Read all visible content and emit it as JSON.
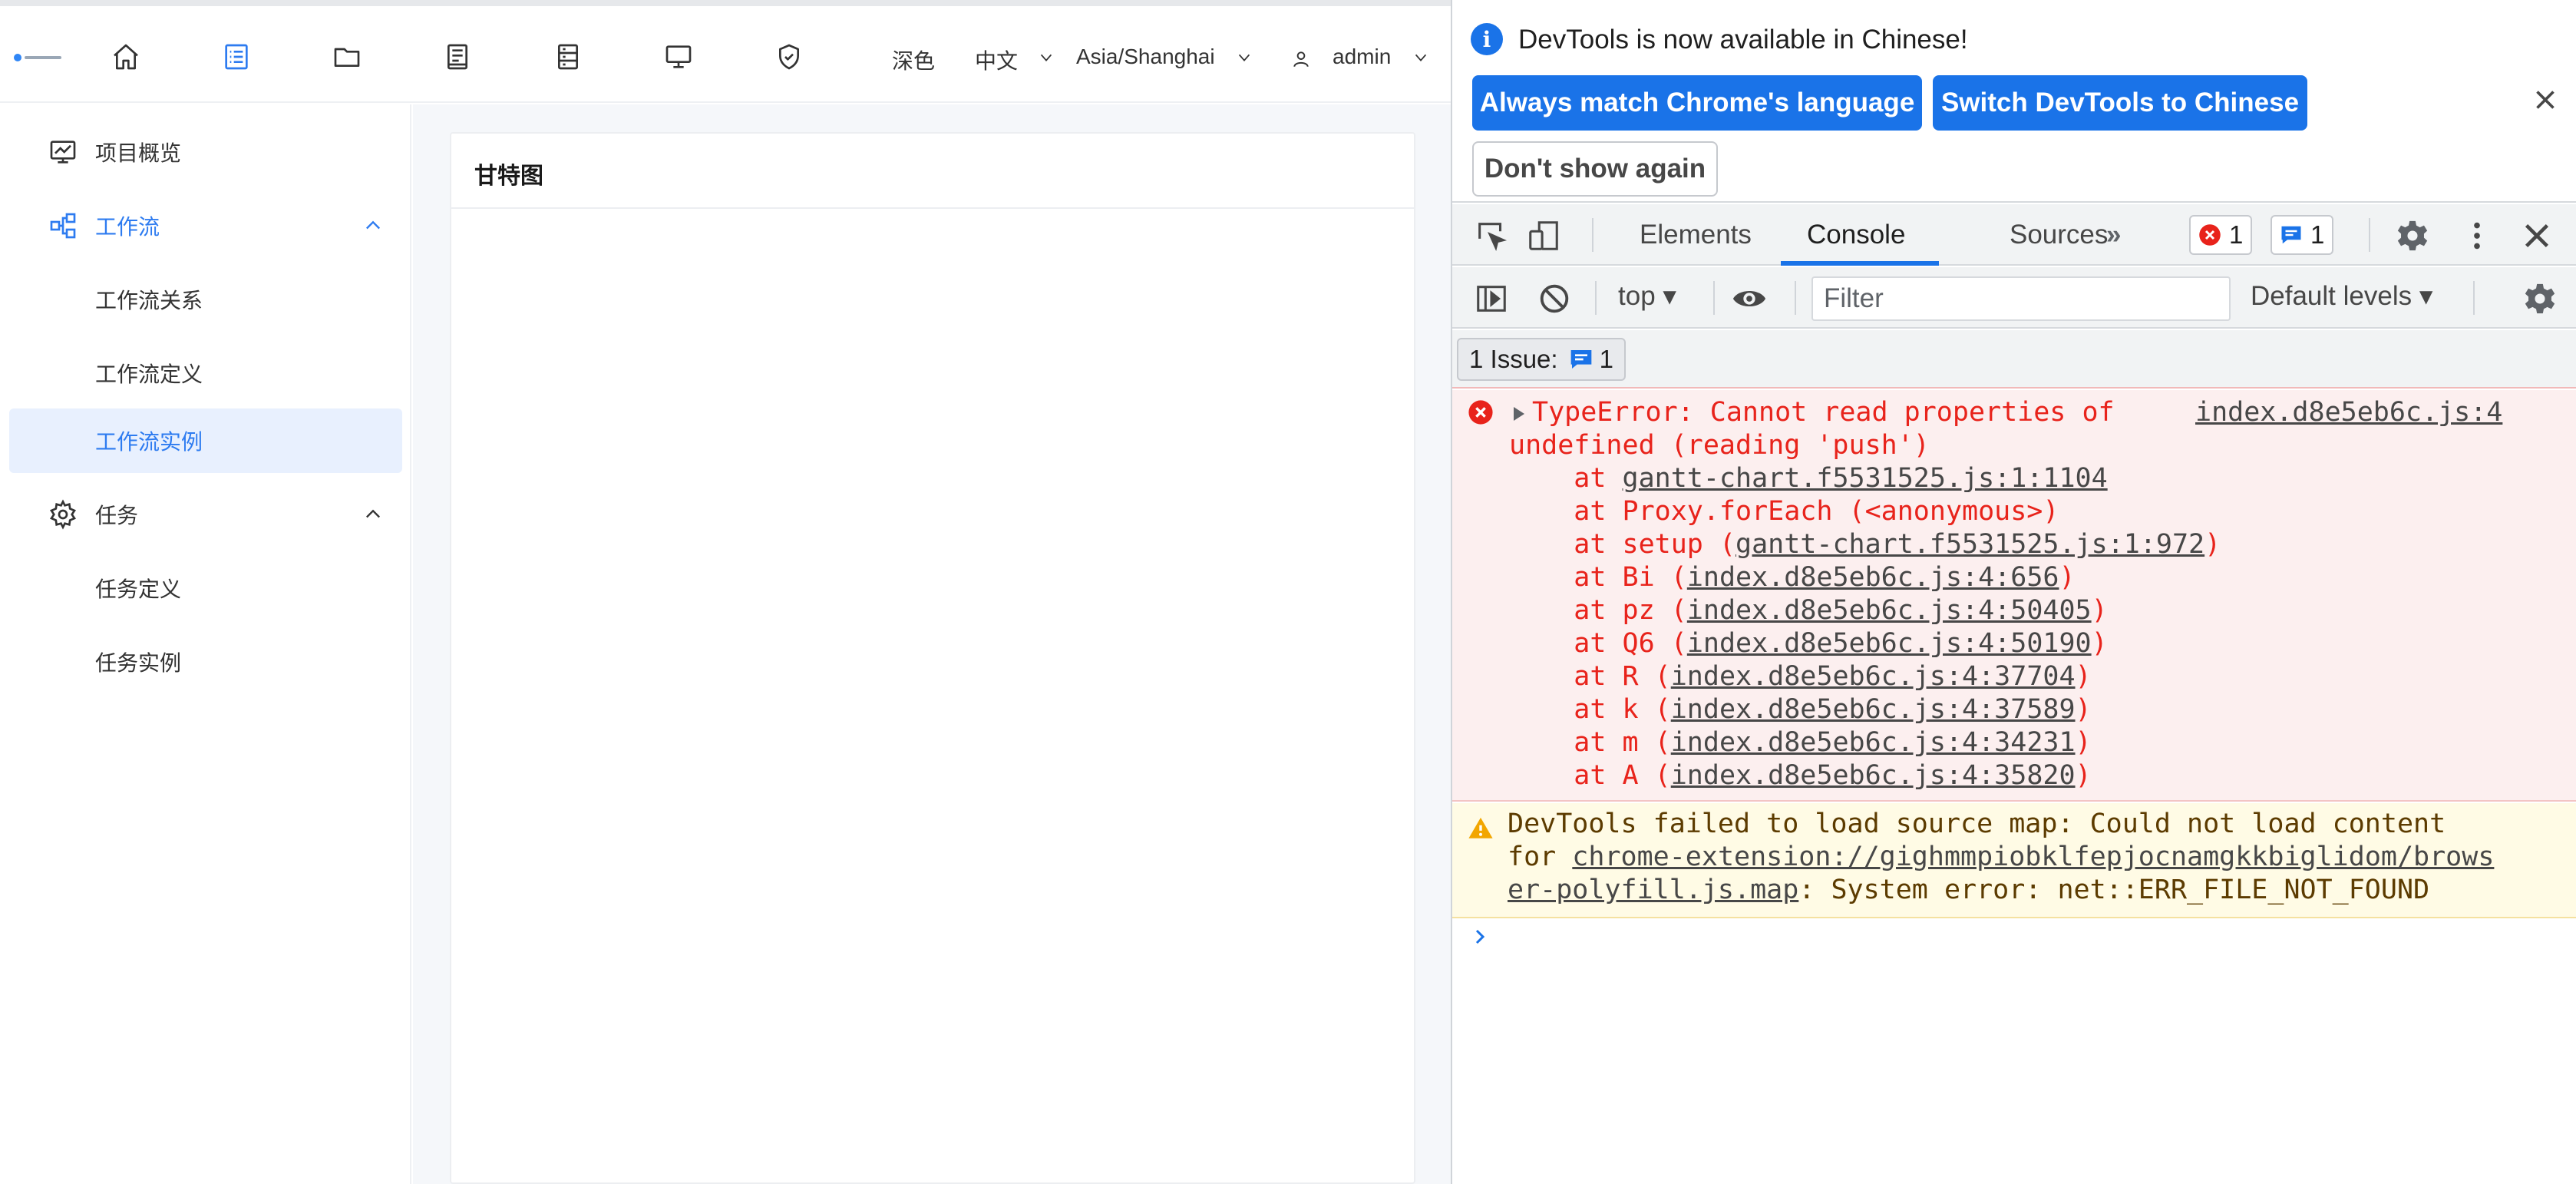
{
  "header": {
    "theme_label": "深色",
    "language_label": "中文",
    "timezone_label": "Asia/Shanghai",
    "user_label": "admin",
    "nav_icons": [
      "home-icon",
      "project-list-icon",
      "folder-icon",
      "resource-icon",
      "datasource-icon",
      "monitor-icon",
      "security-icon"
    ]
  },
  "sidebar": {
    "items": [
      {
        "label": "项目概览",
        "icon": "dashboard-icon"
      },
      {
        "label": "工作流",
        "icon": "workflow-icon"
      },
      {
        "label": "工作流关系"
      },
      {
        "label": "工作流定义"
      },
      {
        "label": "工作流实例"
      },
      {
        "label": "任务",
        "icon": "gear-icon"
      },
      {
        "label": "任务定义"
      },
      {
        "label": "任务实例"
      }
    ]
  },
  "main": {
    "card_title": "甘特图"
  },
  "devtools": {
    "banner": {
      "title": "DevTools is now available in Chinese!",
      "match_button": "Always match Chrome's language",
      "switch_button": "Switch DevTools to Chinese",
      "dismiss_button": "Don't show again"
    },
    "tabs": [
      "Elements",
      "Console",
      "Sources"
    ],
    "active_tab": "Console",
    "error_count": "1",
    "message_count": "1",
    "toolbar": {
      "context": "top",
      "filter_placeholder": "Filter",
      "levels": "Default levels"
    },
    "issues": {
      "label": "1 Issue:",
      "count": "1"
    },
    "error": {
      "message_line1": "TypeError: Cannot read properties of",
      "message_line2": "undefined (reading 'push')",
      "source": "index.d8e5eb6c.js:4",
      "stack": [
        {
          "prefix": "    at ",
          "func": "",
          "link": "gantt-chart.f5531525.js:1:1104",
          "suffix": ""
        },
        {
          "prefix": "    at ",
          "func": "Proxy.forEach (<anonymous>)",
          "link": "",
          "suffix": ""
        },
        {
          "prefix": "    at ",
          "func": "setup (",
          "link": "gantt-chart.f5531525.js:1:972",
          "suffix": ")"
        },
        {
          "prefix": "    at ",
          "func": "Bi (",
          "link": "index.d8e5eb6c.js:4:656",
          "suffix": ")"
        },
        {
          "prefix": "    at ",
          "func": "pz (",
          "link": "index.d8e5eb6c.js:4:50405",
          "suffix": ")"
        },
        {
          "prefix": "    at ",
          "func": "Q6 (",
          "link": "index.d8e5eb6c.js:4:50190",
          "suffix": ")"
        },
        {
          "prefix": "    at ",
          "func": "R (",
          "link": "index.d8e5eb6c.js:4:37704",
          "suffix": ")"
        },
        {
          "prefix": "    at ",
          "func": "k (",
          "link": "index.d8e5eb6c.js:4:37589",
          "suffix": ")"
        },
        {
          "prefix": "    at ",
          "func": "m (",
          "link": "index.d8e5eb6c.js:4:34231",
          "suffix": ")"
        },
        {
          "prefix": "    at ",
          "func": "A (",
          "link": "index.d8e5eb6c.js:4:35820",
          "suffix": ")"
        }
      ]
    },
    "warning": {
      "line1": "DevTools failed to load source map: Could not load content",
      "line2_prefix": "for ",
      "line2_link": "chrome-extension://gighmmpiobklfepjocnamgkkbiglidom/brows",
      "line3_link": "er-polyfill.js.map",
      "line3_suffix": ": System error: net::ERR_FILE_NOT_FOUND"
    },
    "colors": {
      "accent": "#1a73e8",
      "error_text": "#e8231b",
      "error_bg": "#fcefef",
      "warning_bg": "#fffbe5"
    }
  }
}
